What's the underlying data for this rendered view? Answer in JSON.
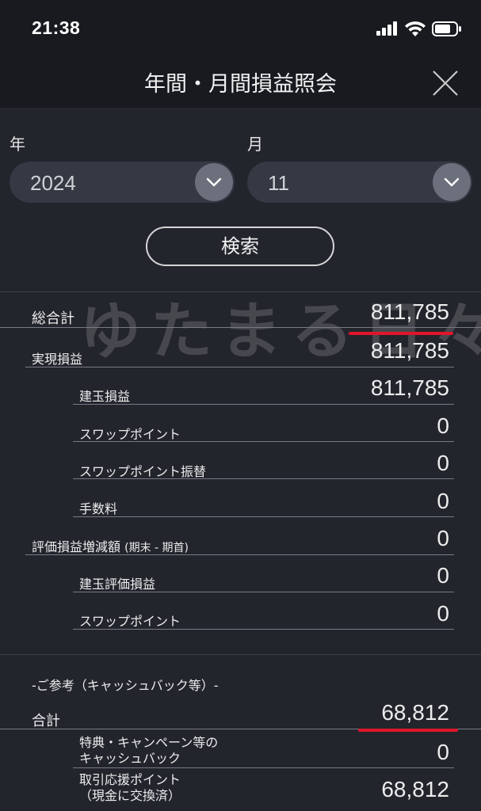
{
  "status_bar": {
    "time": "21:38"
  },
  "nav": {
    "title": "年間・月間損益照会"
  },
  "filters": {
    "year_label": "年",
    "year_value": "2024",
    "month_label": "月",
    "month_value": "11",
    "search_label": "検索"
  },
  "watermark": "ゆたまる日々",
  "rows": [
    {
      "label": "総合計",
      "value": "811,785"
    },
    {
      "label": "実現損益",
      "value": "811,785"
    },
    {
      "label": "建玉損益",
      "value": "811,785"
    },
    {
      "label": "スワップポイント",
      "value": "0"
    },
    {
      "label": "スワップポイント振替",
      "value": "0"
    },
    {
      "label": "手数料",
      "value": "0"
    },
    {
      "label": "評価損益増減額",
      "label_suffix": "(期末 - 期首)",
      "value": "0"
    },
    {
      "label": "建玉評価損益",
      "value": "0"
    },
    {
      "label": "スワップポイント",
      "value": "0"
    }
  ],
  "reference": {
    "heading": "-ご参考（キャッシュバック等）-",
    "total_label": "合計",
    "total_value": "68,812",
    "items": [
      {
        "label_line1": "特典・キャンペーン等の",
        "label_line2": "キャッシュバック",
        "value": "0"
      },
      {
        "label_line1": "取引応援ポイント",
        "label_line2": "（現金に交換済）",
        "value": "68,812"
      }
    ]
  },
  "colors": {
    "background": "#23252d",
    "header": "#181a20",
    "select": "#353944",
    "annotation_red": "#e0162b"
  }
}
